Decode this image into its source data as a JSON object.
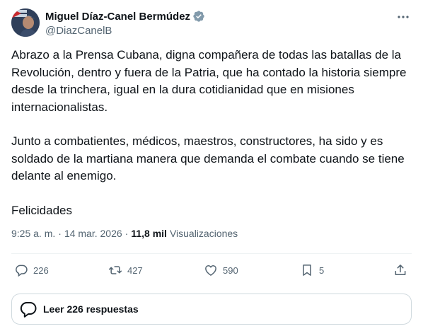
{
  "author": {
    "display_name": "Miguel Díaz-Canel Bermúdez",
    "handle": "@DiazCanelB"
  },
  "tweet": {
    "paragraphs": [
      "Abrazo a la Prensa Cubana, digna compañera de todas las batallas de la Revolución, dentro y fuera de la Patria, que ha contado la historia siempre desde la trinchera, igual en la dura cotidianidad que en misiones internacionalistas.",
      "Junto a combatientes, médicos, maestros, constructores, ha sido y es soldado de la martiana manera que demanda el combate cuando se tiene delante al enemigo.",
      "Felicidades"
    ],
    "time": "9:25 a. m.",
    "separator": "·",
    "date": "14 mar. 2026",
    "views_count": "11,8 mil",
    "views_label": "Visualizaciones"
  },
  "actions": {
    "replies": "226",
    "reposts": "427",
    "likes": "590",
    "bookmarks": "5"
  },
  "read_replies_label": "Leer 226 respuestas",
  "colors": {
    "text": "#0f1419",
    "secondary": "#536471",
    "verified": "#829aab",
    "border": "#cfd9de"
  },
  "icons": [
    "more-options-icon",
    "verified-badge-icon",
    "reply-icon",
    "repost-icon",
    "like-icon",
    "bookmark-icon",
    "share-icon",
    "replies-bubble-icon"
  ]
}
